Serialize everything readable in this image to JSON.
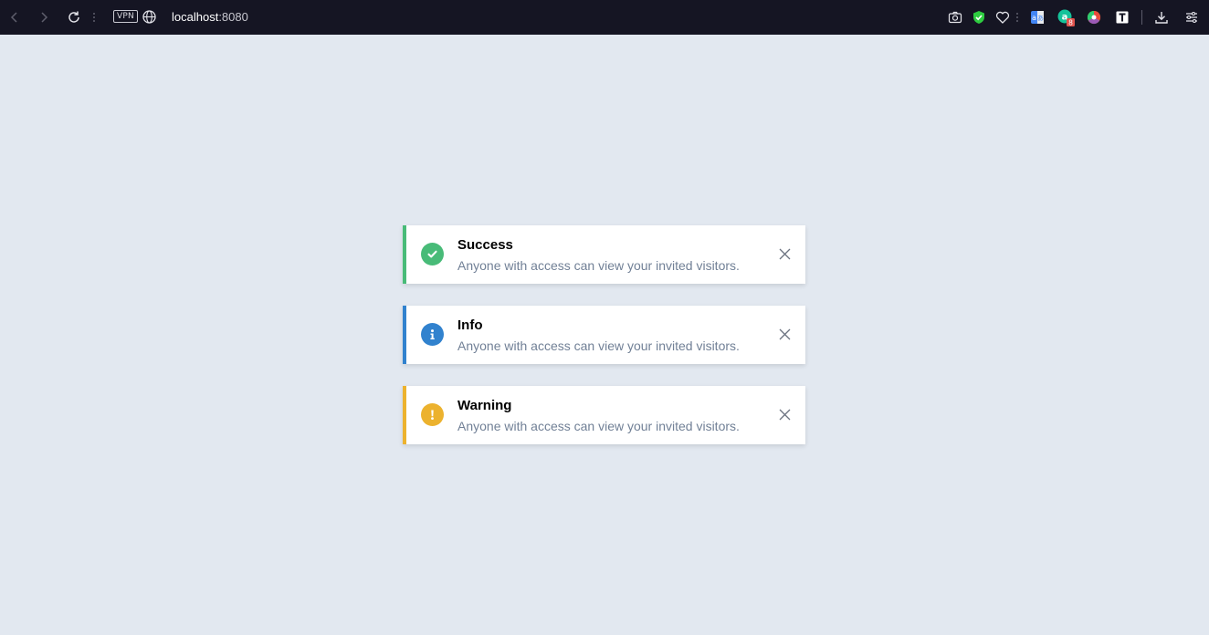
{
  "browser": {
    "url_host": "localhost",
    "url_port": ":8080",
    "vpn_label": "VPN",
    "badge_count": "8"
  },
  "alerts": [
    {
      "title": "Success",
      "message": "Anyone with access can view your invited visitors.",
      "color": "#48bb78",
      "icon": "check-circle-icon"
    },
    {
      "title": "Info",
      "message": "Anyone with access can view your invited visitors.",
      "color": "#3182ce",
      "icon": "info-circle-icon"
    },
    {
      "title": "Warning",
      "message": "Anyone with access can view your invited visitors.",
      "color": "#ecb22e",
      "icon": "exclamation-circle-icon"
    }
  ]
}
